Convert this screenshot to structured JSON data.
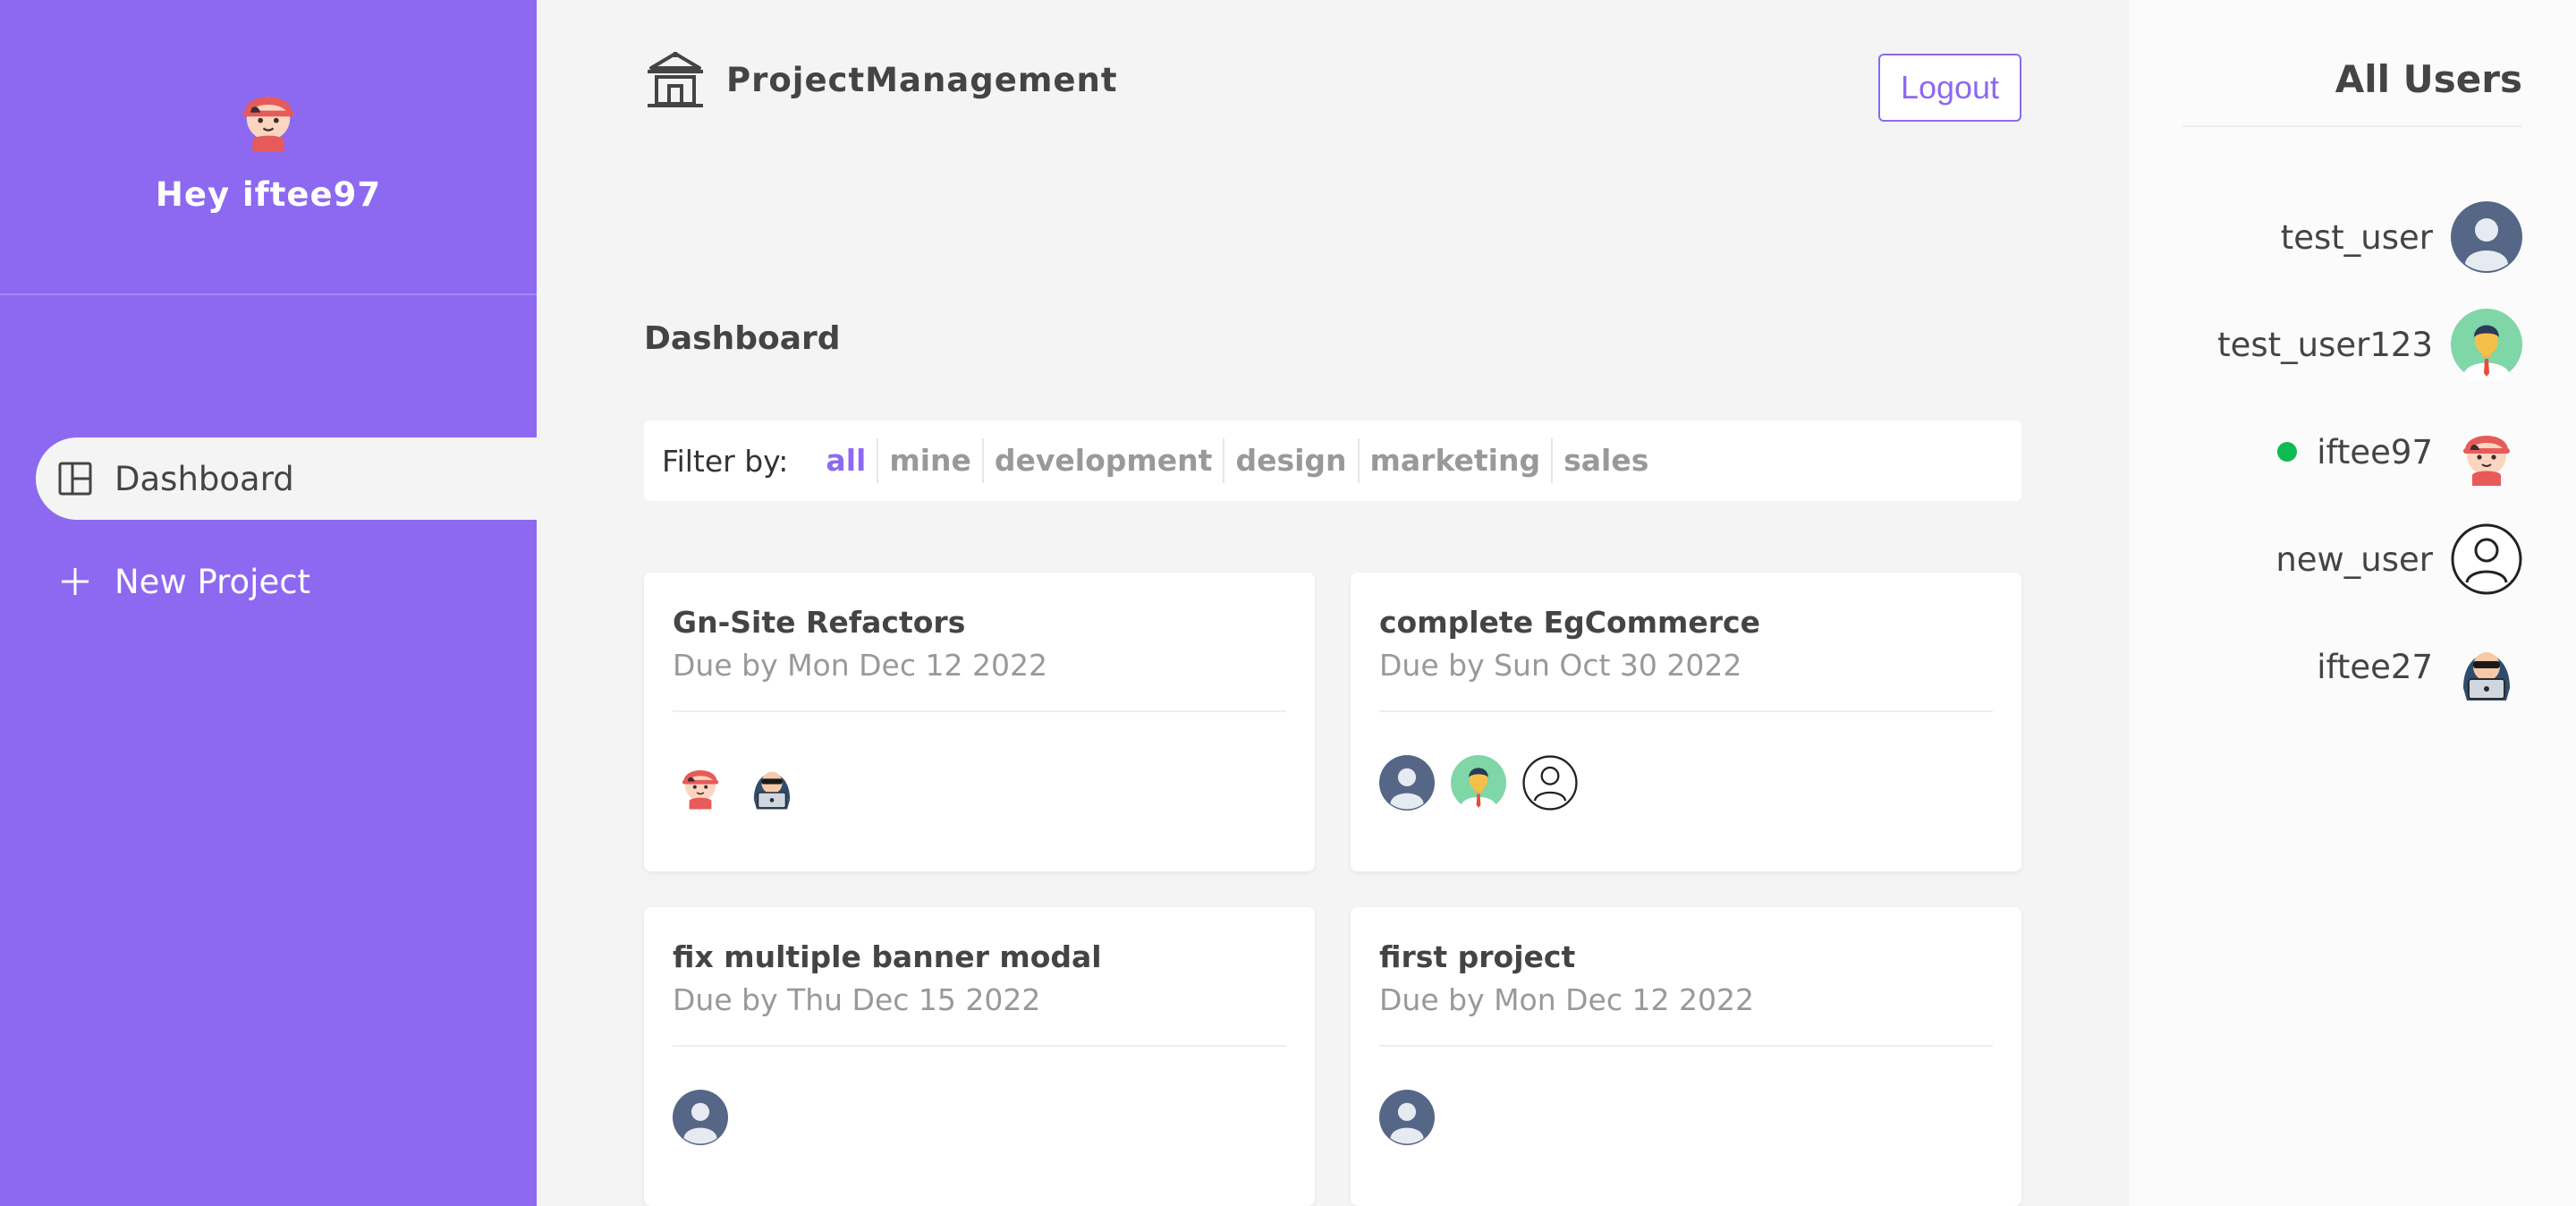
{
  "sidebar": {
    "greeting": "Hey iftee97",
    "nav": [
      {
        "label": "Dashboard",
        "icon": "layout-icon",
        "active": true
      },
      {
        "label": "New Project",
        "icon": "plus-icon",
        "active": false
      }
    ]
  },
  "header": {
    "brand": "ProjectManagement",
    "logout": "Logout"
  },
  "main": {
    "title": "Dashboard",
    "filter": {
      "label": "Filter by:",
      "options": [
        "all",
        "mine",
        "development",
        "design",
        "marketing",
        "sales"
      ],
      "selected": "all"
    },
    "projects": [
      {
        "name": "Gn-Site Refactors",
        "due": "Due by Mon Dec 12 2022",
        "assigned": [
          "iftee97",
          "iftee27"
        ]
      },
      {
        "name": "complete EgCommerce",
        "due": "Due by Sun Oct 30 2022",
        "assigned": [
          "test_user",
          "test_user123",
          "new_user"
        ]
      },
      {
        "name": "fix multiple banner modal",
        "due": "Due by Thu Dec 15 2022",
        "assigned": [
          "test_user"
        ]
      },
      {
        "name": "first project",
        "due": "Due by Mon Dec 12 2022",
        "assigned": [
          "test_user"
        ]
      }
    ]
  },
  "users_panel": {
    "title": "All Users",
    "users": [
      {
        "name": "test_user",
        "online": false
      },
      {
        "name": "test_user123",
        "online": false
      },
      {
        "name": "iftee97",
        "online": true
      },
      {
        "name": "new_user",
        "online": false
      },
      {
        "name": "iftee27",
        "online": false
      }
    ]
  },
  "colors": {
    "accent": "#8d69f1",
    "online": "#0ebb50",
    "background": "#f4f4f4"
  }
}
